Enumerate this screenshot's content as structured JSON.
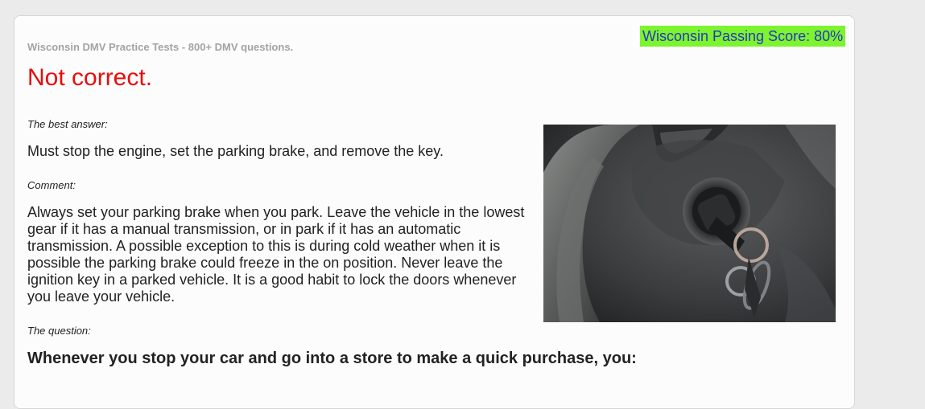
{
  "site_title": "Wisconsin DMV Practice Tests - 800+ DMV questions.",
  "passing_score": "Wisconsin Passing Score: 80%",
  "result": "Not correct.",
  "best_answer_label": "The best answer:",
  "best_answer": "Must stop the engine, set the parking brake, and remove the key.",
  "comment_label": "Comment:",
  "comment": "Always set your parking brake when you park. Leave the vehicle in the lowest gear if it has a manual transmission, or in park if it has an automatic transmission. A possible exception to this is during cold weather when it is possible the parking brake could freeze in the on position. Never leave the ignition key in a parked vehicle. It is a good habit to lock the doors whenever you leave your vehicle.",
  "question_label": "The question:",
  "question": "Whenever you stop your car and go into a store to make a quick purchase, you:",
  "colors": {
    "page_bg": "#ebebeb",
    "card_bg": "#fcfcfc",
    "result": "#ea0c0c",
    "badge_bg": "#7cf42e",
    "badge_text": "#2a34c6"
  }
}
